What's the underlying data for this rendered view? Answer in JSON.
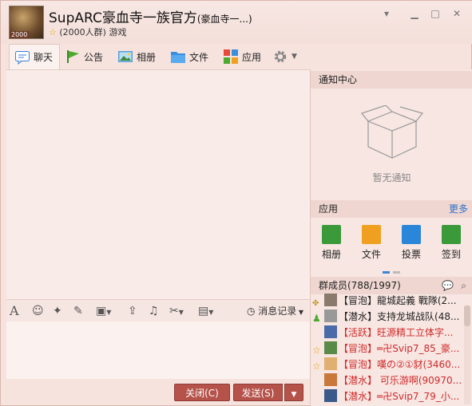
{
  "title": {
    "group_name": "SupARC豪血寺一族官方",
    "group_name_sub": "(豪血寺一...)",
    "meta": "(2000人群)  游戏",
    "avatar_badge": "2000"
  },
  "tabs": [
    {
      "label": "聊天",
      "icon": "chat-bubble-icon"
    },
    {
      "label": "公告",
      "icon": "flag-icon"
    },
    {
      "label": "相册",
      "icon": "photo-album-icon"
    },
    {
      "label": "文件",
      "icon": "folder-icon"
    },
    {
      "label": "应用",
      "icon": "apps-grid-icon"
    }
  ],
  "toolbar": {
    "history_label": "消息记录",
    "close_label": "关闭(C)",
    "send_label": "发送(S)"
  },
  "notice": {
    "title": "通知中心",
    "empty_text": "暂无通知"
  },
  "apps": {
    "title": "应用",
    "more": "更多",
    "items": [
      {
        "label": "相册",
        "color": "#3a9a3a"
      },
      {
        "label": "文件",
        "color": "#f0a020"
      },
      {
        "label": "投票",
        "color": "#2a86d8"
      },
      {
        "label": "签到",
        "color": "#3a9a3a"
      }
    ]
  },
  "members": {
    "title": "群成员(788/1997)",
    "items": [
      {
        "role": "【冒泡】",
        "name": "龍城起義 戰隊(2...",
        "color": "#222222"
      },
      {
        "role": "【潜水】",
        "name": "支持龙城战队(48...",
        "color": "#222222"
      },
      {
        "role": "【活跃】",
        "name": "旺源精工立体字...",
        "color": "#d12a2a"
      },
      {
        "role": "【冒泡】",
        "name": "═卍Svip7_85_豪...",
        "color": "#d12a2a"
      },
      {
        "role": "【冒泡】",
        "name": "嘆の②①豺(3460...",
        "color": "#d12a2a"
      },
      {
        "role": "【潜水】",
        "name": "  可乐游啊(90970...",
        "color": "#d12a2a"
      },
      {
        "role": "【潜水】",
        "name": "═卍Svip7_79_小...",
        "color": "#d12a2a"
      }
    ]
  },
  "colors": {
    "accent_button": "#b5524a",
    "link": "#2a6fc9",
    "vip_text": "#d12a2a"
  }
}
